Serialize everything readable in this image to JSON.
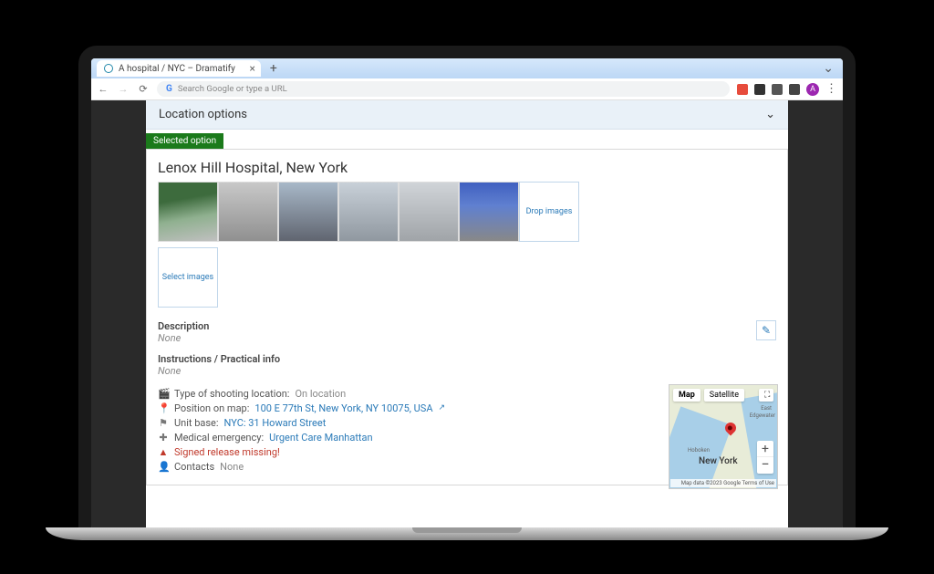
{
  "browser": {
    "tab_title": "A hospital / NYC – Dramatify",
    "omnibox_placeholder": "Search Google or type a URL",
    "back": "←",
    "fwd": "→",
    "reload": "⟳",
    "new_tab": "+",
    "minimize": "⌄",
    "tab_close": "×",
    "menu": "⋮",
    "avatar": "A"
  },
  "panel": {
    "location_options": "Location options",
    "selected_badge": "Selected option",
    "title": "Lenox Hill Hospital, New York",
    "drop_images": "Drop images",
    "select_images": "Select images",
    "description_label": "Description",
    "description_value": "None",
    "instructions_label": "Instructions / Practical info",
    "instructions_value": "None"
  },
  "meta": {
    "type_label": "Type of shooting location:",
    "type_value": "On location",
    "position_label": "Position on map:",
    "position_value": "100 E 77th St, New York, NY 10075, USA",
    "unitbase_label": "Unit base:",
    "unitbase_value": "NYC: 31 Howard Street",
    "medical_label": "Medical emergency:",
    "medical_value": "Urgent Care Manhattan",
    "warn_label": "Signed release missing!",
    "contacts_label": "Contacts",
    "contacts_value": "None"
  },
  "map": {
    "map_btn": "Map",
    "satellite_btn": "Satellite",
    "city_label": "New York",
    "east_lbl": "East",
    "edge_lbl": "Edgewater",
    "hobo_lbl": "Hoboken",
    "zoom_in": "+",
    "zoom_out": "−",
    "fullscreen": "⛶",
    "attribution": "Map data ©2023 Google   Terms of Use"
  }
}
